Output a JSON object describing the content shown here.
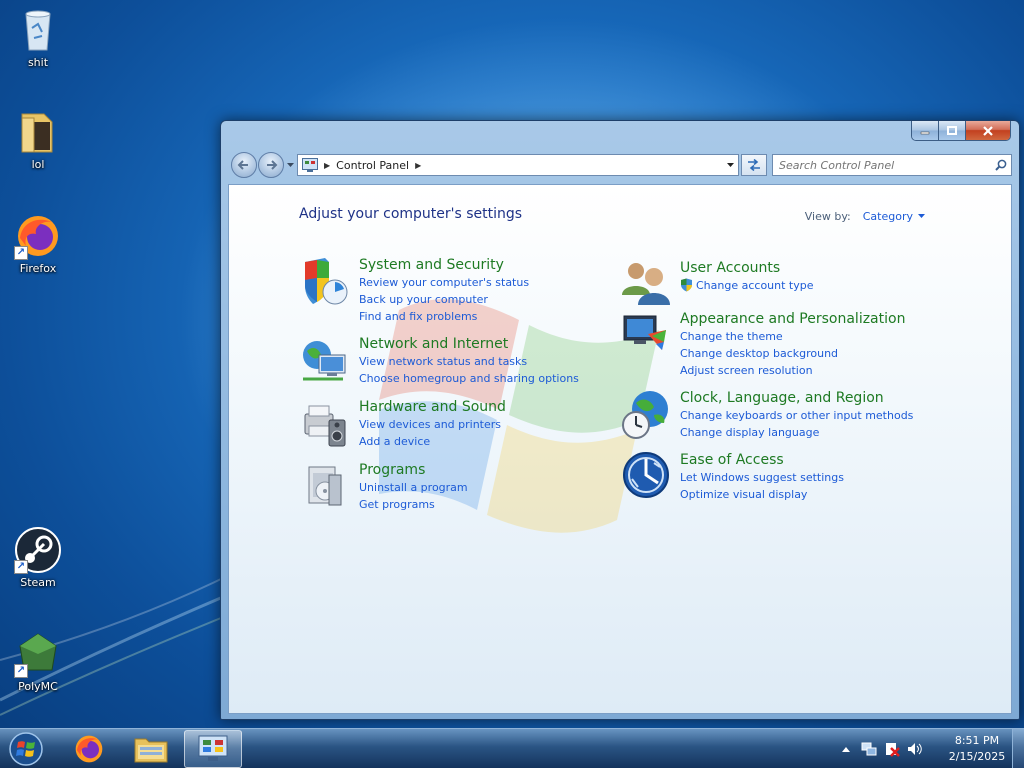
{
  "desktop": {
    "icons": [
      {
        "label": "shit",
        "icon": "recycle-bin-icon"
      },
      {
        "label": "lol",
        "icon": "folder-icon"
      },
      {
        "label": "Firefox",
        "icon": "firefox-icon"
      },
      {
        "label": "Steam",
        "icon": "steam-icon"
      },
      {
        "label": "PolyMC",
        "icon": "polymc-icon"
      }
    ]
  },
  "window": {
    "controls": {
      "minimize": "minimize-icon",
      "maximize": "maximize-icon",
      "close": "close-icon"
    },
    "nav": {
      "back": "back-arrow-icon",
      "forward": "forward-arrow-icon",
      "breadcrumb": [
        "Control Panel"
      ],
      "search_placeholder": "Search Control Panel"
    },
    "content": {
      "title": "Adjust your computer's settings",
      "view_by_label": "View by:",
      "view_by_value": "Category",
      "categories_left": [
        {
          "title": "System and Security",
          "icon": "system-security-icon",
          "links": [
            "Review your computer's status",
            "Back up your computer",
            "Find and fix problems"
          ]
        },
        {
          "title": "Network and Internet",
          "icon": "network-icon",
          "links": [
            "View network status and tasks",
            "Choose homegroup and sharing options"
          ]
        },
        {
          "title": "Hardware and Sound",
          "icon": "hardware-sound-icon",
          "links": [
            "View devices and printers",
            "Add a device"
          ]
        },
        {
          "title": "Programs",
          "icon": "programs-icon",
          "links": [
            "Uninstall a program",
            "Get programs"
          ]
        }
      ],
      "categories_right": [
        {
          "title": "User Accounts",
          "icon": "user-accounts-icon",
          "links": [
            "Change account type"
          ]
        },
        {
          "title": "Appearance and Personalization",
          "icon": "appearance-icon",
          "links": [
            "Change the theme",
            "Change desktop background",
            "Adjust screen resolution"
          ]
        },
        {
          "title": "Clock, Language, and Region",
          "icon": "clock-globe-icon",
          "links": [
            "Change keyboards or other input methods",
            "Change display language"
          ]
        },
        {
          "title": "Ease of Access",
          "icon": "ease-of-access-icon",
          "links": [
            "Let Windows suggest settings",
            "Optimize visual display"
          ]
        }
      ]
    }
  },
  "taskbar": {
    "pinned": [
      "start-orb-icon",
      "firefox-icon",
      "explorer-icon",
      "control-panel-icon"
    ],
    "active": "control-panel-icon",
    "tray": [
      "show-hidden-icons-icon",
      "network-icon",
      "action-center-icon",
      "volume-icon"
    ],
    "clock": {
      "time": "8:51 PM",
      "date": "2/15/2025"
    }
  },
  "colors": {
    "link": "#1d5bd6",
    "category_title": "#1e7a23",
    "page_title": "#1e3287"
  }
}
